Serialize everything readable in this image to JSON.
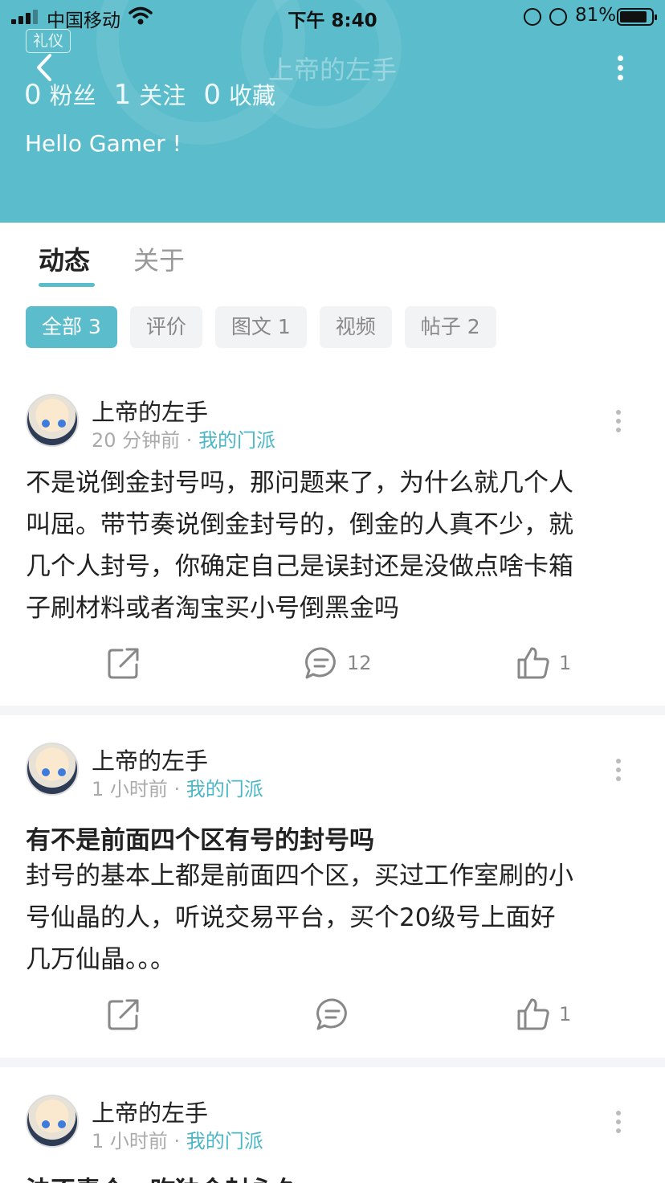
{
  "status_bar": {
    "carrier": "中国移动",
    "time": "下午 8:40",
    "battery": "81%"
  },
  "header": {
    "badge": "礼仪",
    "title": "上帝的左手",
    "stats": [
      {
        "num": "0",
        "label": "粉丝"
      },
      {
        "num": "1",
        "label": "关注"
      },
      {
        "num": "0",
        "label": "收藏"
      }
    ],
    "bio": "Hello Gamer !"
  },
  "tabs": [
    "动态",
    "关于"
  ],
  "filters": [
    "全部 3",
    "评价",
    "图文 1",
    "视频",
    "帖子 2"
  ],
  "posts": [
    {
      "author": "上帝的左手",
      "time": "20 分钟前",
      "group": "我的门派",
      "title": "",
      "lines": [
        "不是说倒金封号吗，那问题来了，为什么就几个人",
        "叫屈。带节奏说倒金封号的，倒金的人真不少，就",
        "几个人封号，你确定自己是误封还是没做点啥卡箱",
        "子刷材料或者淘宝买小号倒黑金吗"
      ],
      "comments": "12",
      "likes": "1"
    },
    {
      "author": "上帝的左手",
      "time": "1 小时前",
      "group": "我的门派",
      "title": "有不是前面四个区有号的封号吗",
      "lines": [
        "封号的基本上都是前面四个区，买过工作室刷的小",
        "号仙晶的人，听说交易平台，买个20级号上面好",
        "几万仙晶。。。"
      ],
      "comments": "",
      "likes": "1"
    },
    {
      "author": "上帝的左手",
      "time": "1 小时前",
      "group": "我的门派",
      "title": "法不责众，昨独金封永久",
      "lines": [],
      "comments": "",
      "likes": ""
    }
  ],
  "colors": {
    "accent": "#5bbccb",
    "group_link": "#4bb6c6",
    "chip_bg": "#f2f3f5"
  },
  "icons": [
    "signal-icon",
    "wifi-icon",
    "battery-icon",
    "back-arrow-icon",
    "more-vertical-icon",
    "share-icon",
    "comment-icon",
    "like-icon"
  ]
}
